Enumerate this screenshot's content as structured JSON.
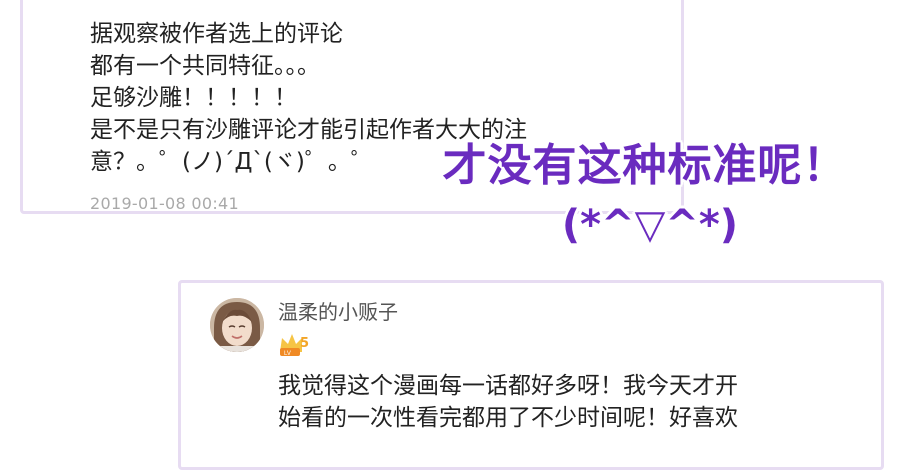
{
  "top_comment": {
    "lines": [
      "据观察被作者选上的评论",
      "都有一个共同特征。。。",
      "足够沙雕！！！！！",
      "是不是只有沙雕评论才能引起作者大大的注",
      "意？。゜(ノ)´Д`(ヾ)゜。゜"
    ],
    "timestamp": "2019-01-08 00:41"
  },
  "overlay": {
    "line1": "才没有这种标准呢！",
    "line2": "(*^▽^*)",
    "color": "#6a2bbf"
  },
  "bottom_comment": {
    "username": "温柔的小贩子",
    "level": "5",
    "lines": [
      "我觉得这个漫画每一话都好多呀！我今天才开",
      "始看的一次性看完都用了不少时间呢！好喜欢"
    ]
  },
  "colors": {
    "card_border": "#e7dcf2",
    "timestamp": "#a9a9a9",
    "badge": "#f3a528"
  }
}
